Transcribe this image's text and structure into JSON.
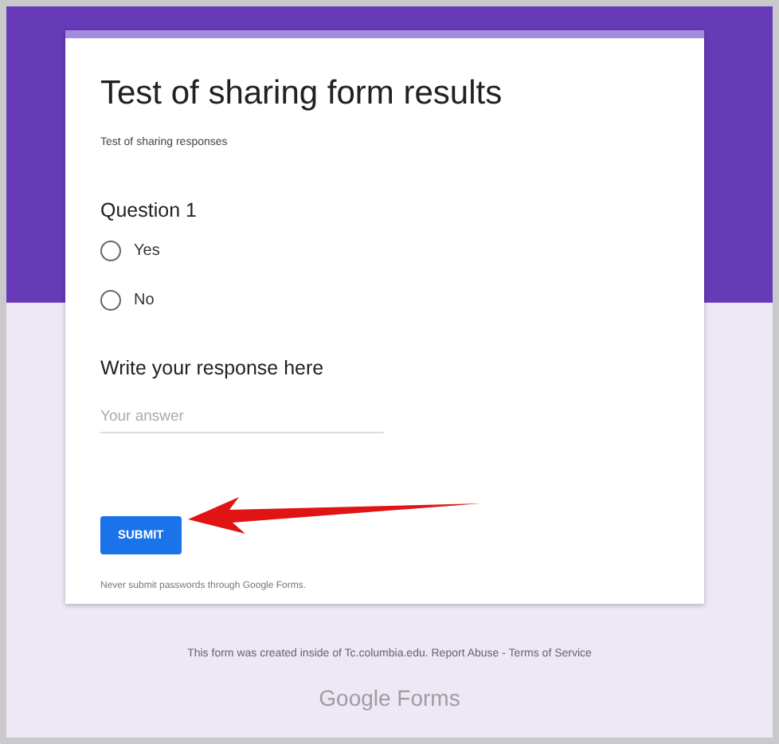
{
  "form": {
    "title": "Test of sharing form results",
    "description": "Test of sharing responses",
    "questions": [
      {
        "kind": "choice",
        "title": "Question 1",
        "options": [
          {
            "label": "Yes",
            "selected": false
          },
          {
            "label": "No",
            "selected": false
          }
        ]
      },
      {
        "kind": "text",
        "title": "Write your response here",
        "placeholder": "Your answer"
      }
    ],
    "submit": "SUBMIT",
    "notice": "Never submit passwords through Google Forms."
  },
  "footer": {
    "text": "This form was created inside of Tc.columbia.edu.",
    "links": [
      "Report Abuse",
      "Terms of Service"
    ],
    "separator": "-",
    "brand": [
      "Google",
      "Forms"
    ]
  }
}
